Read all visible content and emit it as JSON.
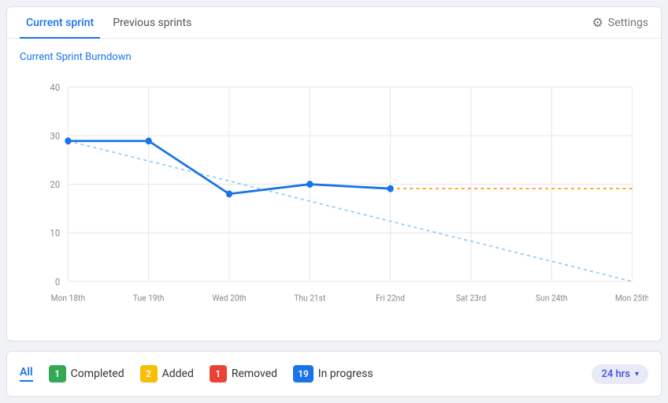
{
  "tabs": {
    "current": "Current sprint",
    "previous": "Previous sprints"
  },
  "settings": {
    "label": "Settings"
  },
  "chart": {
    "title": "Current Sprint Burndown",
    "yMax": 40,
    "yValues": [
      40,
      30,
      20,
      10,
      0
    ],
    "xLabels": [
      "Mon 18th",
      "Tue 19th",
      "Wed 20th",
      "Thu 21st",
      "Fri 22nd",
      "Sat 23rd",
      "Sun 24th",
      "Mon 25th"
    ]
  },
  "filters": {
    "all": "All",
    "completed": {
      "count": "1",
      "label": "Completed"
    },
    "added": {
      "count": "2",
      "label": "Added"
    },
    "removed": {
      "count": "1",
      "label": "Removed"
    },
    "inprogress": {
      "count": "19",
      "label": "In progress"
    },
    "timerange": "24 hrs"
  }
}
